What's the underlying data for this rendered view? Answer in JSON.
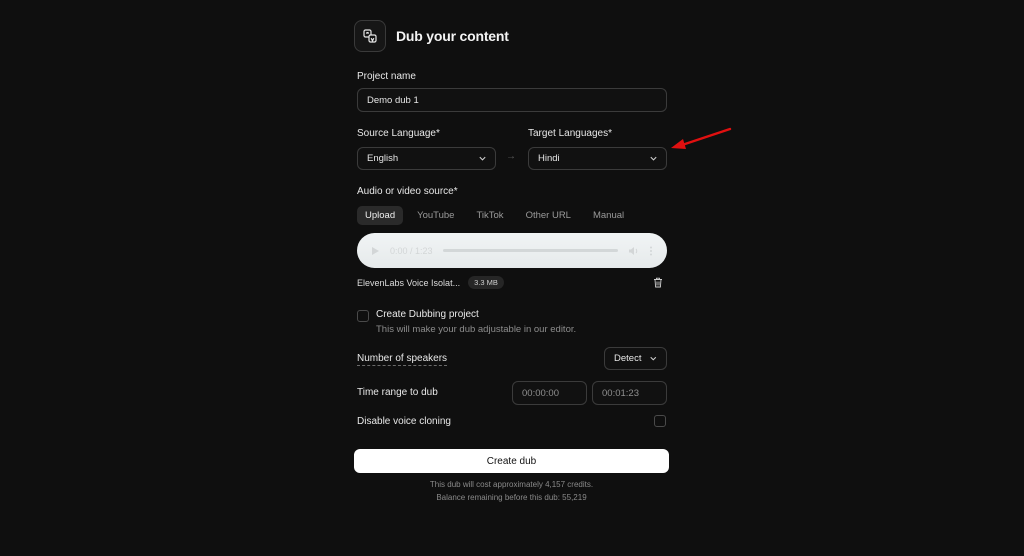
{
  "header": {
    "title": "Dub your content",
    "icon": "translate-icon"
  },
  "project": {
    "label": "Project name",
    "value": "Demo dub 1"
  },
  "languages": {
    "source_label": "Source Language*",
    "source_value": "English",
    "target_label": "Target Languages*",
    "target_value": "Hindi",
    "arrow": "→"
  },
  "source": {
    "label": "Audio or video source*",
    "tabs": [
      "Upload",
      "YouTube",
      "TikTok",
      "Other URL",
      "Manual"
    ],
    "active_tab": "Upload"
  },
  "player": {
    "time": "0:00 / 1:23",
    "progress": 0.0
  },
  "file": {
    "name": "ElevenLabs Voice Isolat...",
    "size": "3.3 MB"
  },
  "dubbing_project": {
    "title": "Create Dubbing project",
    "subtitle": "This will make your dub adjustable in our editor."
  },
  "speakers": {
    "label": "Number of speakers",
    "value": "Detect"
  },
  "time_range": {
    "label": "Time range to dub",
    "start": "00:00:00",
    "end": "00:01:23"
  },
  "voice_cloning": {
    "label": "Disable voice cloning"
  },
  "create": {
    "label": "Create dub"
  },
  "footer": {
    "cost": "This dub will cost approximately 4,157 credits.",
    "balance": "Balance remaining before this dub: 55,219"
  },
  "colors": {
    "background": "#0f0f0f",
    "annotation_arrow": "#e01010"
  }
}
